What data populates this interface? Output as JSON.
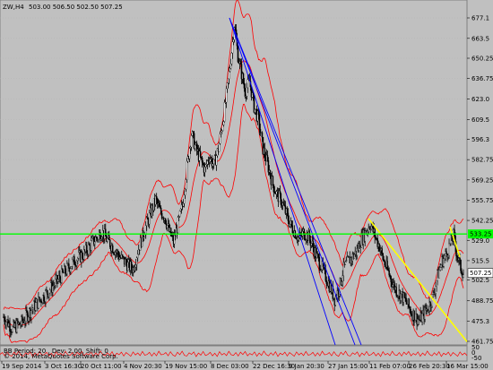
{
  "chart_data": {
    "type": "candlestick",
    "symbol_label": "ZW,H4",
    "ohlc_header": "503.00 506.50 502.50 507.25",
    "indicator_label": "BB Period: 20 , Dev: 2.00, Shift: 0",
    "source_label": "© 2014, MetaQuotes Software Corp.",
    "y_ticks": [
      "677.1",
      "663.5",
      "650.25",
      "636.75",
      "623.0",
      "609.5",
      "596.3",
      "582.75",
      "569.25",
      "555.75",
      "542.25",
      "529.0",
      "515.5",
      "502.5",
      "488.75",
      "475.3",
      "461.75"
    ],
    "y_tick_values": [
      677.1,
      663.5,
      650.25,
      636.75,
      623.0,
      609.5,
      596.3,
      582.75,
      569.25,
      555.75,
      542.25,
      529.0,
      515.5,
      502.5,
      488.75,
      475.3,
      461.75
    ],
    "x_ticks": [
      "19 Sep 2014",
      "3 Oct 16:30",
      "20 Oct 11:00",
      "4 Nov 20:30",
      "19 Nov 15:00",
      "8 Dec 03:00",
      "22 Dec 16:30",
      "9 Jan 20:30",
      "27 Jan 15:00",
      "11 Feb 07:00",
      "26 Feb 20:30",
      "16 Mar 15:00"
    ],
    "horizontal_line": {
      "value": 533.25,
      "label": "533.25",
      "color": "#00ff00"
    },
    "current_price": {
      "value": 507.25,
      "label": "507.25"
    },
    "osc_ticks": [
      "50",
      "0",
      "-50"
    ],
    "ylim": [
      455,
      682
    ],
    "colors": {
      "background": "#c0c0c0",
      "candles": "#000000",
      "bands": "#ff0000",
      "trend_blue": "#0000ff",
      "trend_yellow": "#ffff00",
      "grid": "#a0a0a0"
    },
    "close_path": [
      [
        0,
        478
      ],
      [
        10,
        470
      ],
      [
        20,
        474
      ],
      [
        30,
        482
      ],
      [
        40,
        489
      ],
      [
        50,
        495
      ],
      [
        60,
        502
      ],
      [
        70,
        509
      ],
      [
        80,
        516
      ],
      [
        90,
        520
      ],
      [
        100,
        528
      ],
      [
        110,
        535
      ],
      [
        115,
        530
      ],
      [
        120,
        526
      ],
      [
        130,
        518
      ],
      [
        140,
        512
      ],
      [
        145,
        510
      ],
      [
        150,
        522
      ],
      [
        160,
        540
      ],
      [
        170,
        556
      ],
      [
        175,
        548
      ],
      [
        180,
        545
      ],
      [
        185,
        535
      ],
      [
        190,
        528
      ],
      [
        195,
        540
      ],
      [
        200,
        552
      ],
      [
        205,
        578
      ],
      [
        210,
        600
      ],
      [
        215,
        590
      ],
      [
        220,
        583
      ],
      [
        225,
        576
      ],
      [
        230,
        585
      ],
      [
        235,
        579
      ],
      [
        240,
        590
      ],
      [
        245,
        608
      ],
      [
        250,
        630
      ],
      [
        255,
        655
      ],
      [
        258,
        673
      ],
      [
        262,
        652
      ],
      [
        266,
        640
      ],
      [
        270,
        628
      ],
      [
        275,
        635
      ],
      [
        280,
        618
      ],
      [
        285,
        609
      ],
      [
        290,
        590
      ],
      [
        295,
        580
      ],
      [
        300,
        568
      ],
      [
        305,
        560
      ],
      [
        310,
        556
      ],
      [
        315,
        548
      ],
      [
        320,
        540
      ],
      [
        325,
        535
      ],
      [
        330,
        530
      ],
      [
        335,
        534
      ],
      [
        340,
        532
      ],
      [
        345,
        526
      ],
      [
        350,
        518
      ],
      [
        355,
        512
      ],
      [
        360,
        505
      ],
      [
        365,
        498
      ],
      [
        370,
        490
      ],
      [
        375,
        497
      ],
      [
        380,
        510
      ],
      [
        385,
        515
      ],
      [
        390,
        518
      ],
      [
        395,
        522
      ],
      [
        400,
        530
      ],
      [
        405,
        535
      ],
      [
        410,
        540
      ],
      [
        415,
        532
      ],
      [
        420,
        525
      ],
      [
        425,
        515
      ],
      [
        430,
        508
      ],
      [
        435,
        500
      ],
      [
        440,
        495
      ],
      [
        445,
        492
      ],
      [
        450,
        488
      ],
      [
        455,
        482
      ],
      [
        460,
        478
      ],
      [
        465,
        476
      ],
      [
        470,
        480
      ],
      [
        475,
        485
      ],
      [
        480,
        492
      ],
      [
        485,
        505
      ],
      [
        490,
        515
      ],
      [
        495,
        520
      ],
      [
        500,
        528
      ],
      [
        503,
        532
      ],
      [
        506,
        522
      ],
      [
        510,
        512
      ],
      [
        514,
        507
      ]
    ],
    "osc_values": [
      5,
      -12,
      18,
      -20,
      10,
      22,
      -15,
      8,
      -25,
      14,
      20,
      -10,
      5,
      -18,
      25,
      -8,
      12,
      -22,
      15,
      6,
      -14,
      18,
      -6,
      24,
      -20,
      10,
      -5,
      16,
      -24,
      8,
      14,
      -12,
      20,
      -16,
      6,
      -22,
      18,
      -4,
      10,
      -18,
      22,
      -8,
      14,
      -26,
      6,
      18,
      -10,
      12,
      -20,
      24,
      -6,
      8,
      -16,
      20,
      -12,
      4,
      22,
      -18,
      10,
      -8,
      16,
      -22,
      12,
      6,
      -14,
      20,
      -10,
      18,
      -24,
      8
    ],
    "trend_lines": [
      {
        "color": "#0000ff",
        "from": [
          "8 Dec 03:00",
          677.1
        ],
        "to": [
          "27 Jan 15:00",
          455
        ]
      },
      {
        "color": "#0000ff",
        "from": [
          "8 Dec 03:00",
          677.1
        ],
        "to": [
          "11 Feb 07:00",
          455
        ]
      },
      {
        "color": "#ffff00",
        "from": [
          "11 Feb 07:00",
          543.5
        ],
        "to": [
          "16 Mar 15:00",
          461.75
        ]
      },
      {
        "color": "#ffff00",
        "from": [
          "16 Mar 15:00",
          533.25
        ],
        "to": [
          "16 Mar 15:00",
          515.5
        ]
      }
    ]
  }
}
